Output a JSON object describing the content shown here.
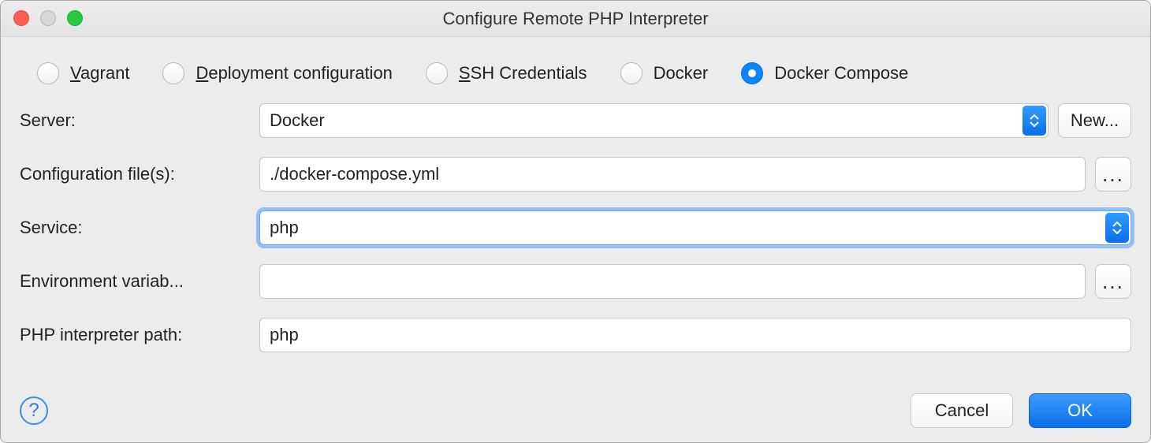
{
  "window": {
    "title": "Configure Remote PHP Interpreter"
  },
  "radios": {
    "vagrant": {
      "label": "Vagrant",
      "ul": "V"
    },
    "deployment": {
      "label": "Deployment configuration",
      "ul": "D"
    },
    "ssh": {
      "label": "SSH Credentials",
      "ul": "S"
    },
    "docker": {
      "label": "Docker"
    },
    "compose": {
      "label": "Docker Compose"
    },
    "selected": "compose"
  },
  "form": {
    "server": {
      "label": "Server:",
      "value": "Docker",
      "button": "New..."
    },
    "config": {
      "label": "Configuration file(s):",
      "value": "./docker-compose.yml",
      "button": "..."
    },
    "service": {
      "label": "Service:",
      "value": "php"
    },
    "env": {
      "label": "Environment variab...",
      "value": "",
      "button": "..."
    },
    "phppath": {
      "label": "PHP interpreter path:",
      "value": "php"
    }
  },
  "footer": {
    "cancel": "Cancel",
    "ok": "OK"
  }
}
